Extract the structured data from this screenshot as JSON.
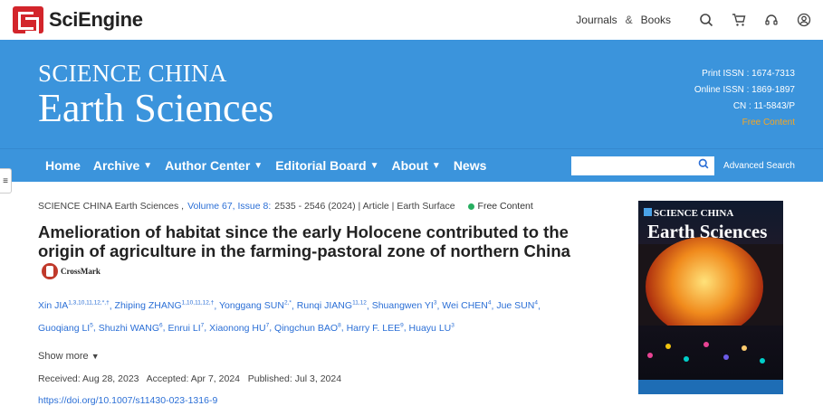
{
  "site": {
    "logo_text": "SciEngine",
    "nav_journals": "Journals",
    "nav_amp": "&",
    "nav_books": "Books",
    "icons": [
      "search-icon",
      "cart-icon",
      "headset-icon",
      "user-icon"
    ]
  },
  "banner": {
    "journal_small": "SCIENCE CHINA",
    "journal_big": "Earth Sciences",
    "print_issn": "Print ISSN : 1674-7313",
    "online_issn": "Online ISSN : 1869-1897",
    "cn": "CN : 11-5843/P",
    "free_content": "Free Content",
    "colors": {
      "banner_bg": "#3b94dc",
      "accent": "#f5a623",
      "brand_red": "#d3252b"
    }
  },
  "nav": {
    "items": [
      {
        "label": "Home",
        "dropdown": false
      },
      {
        "label": "Archive",
        "dropdown": true
      },
      {
        "label": "Author Center",
        "dropdown": true
      },
      {
        "label": "Editorial Board",
        "dropdown": true
      },
      {
        "label": "About",
        "dropdown": true
      },
      {
        "label": "News",
        "dropdown": false
      }
    ],
    "search_placeholder": "",
    "advanced_search": "Advanced Search"
  },
  "article": {
    "journal": "SCIENCE CHINA Earth Sciences ,",
    "volume_issue": "Volume 67, Issue 8:",
    "pages_info": "2535 - 2546 (2024) | Article | Earth Surface",
    "free_label": "Free Content",
    "title": "Amelioration of habitat since the early Holocene contributed to the origin of agriculture in the farming-pastoral zone of northern China",
    "crossmark": "CrossMark",
    "authors": [
      {
        "name": "Xin JIA",
        "sup": "1,3,10,11,12,*,†"
      },
      {
        "name": "Zhiping ZHANG",
        "sup": "1,10,11,12,†"
      },
      {
        "name": "Yonggang SUN",
        "sup": "2,*"
      },
      {
        "name": "Runqi JIANG",
        "sup": "11,12"
      },
      {
        "name": "Shuangwen YI",
        "sup": "3"
      },
      {
        "name": "Wei CHEN",
        "sup": "4"
      },
      {
        "name": "Jue SUN",
        "sup": "4"
      },
      {
        "name": "Guoqiang LI",
        "sup": "5"
      },
      {
        "name": "Shuzhi WANG",
        "sup": "6"
      },
      {
        "name": "Enrui LI",
        "sup": "7"
      },
      {
        "name": "Xiaonong HU",
        "sup": "7"
      },
      {
        "name": "Qingchun BAO",
        "sup": "8"
      },
      {
        "name": "Harry F. LEE",
        "sup": "9"
      },
      {
        "name": "Huayu LU",
        "sup": "3"
      }
    ],
    "show_more": "Show more",
    "dates": "Received: Aug 28, 2023   Accepted: Apr 7, 2024   Published: Jul 3, 2024",
    "doi": "https://doi.org/10.1007/s11430-023-1316-9"
  },
  "cover": {
    "title_small": "SCIENCE CHINA",
    "title_big": "Earth Sciences"
  }
}
